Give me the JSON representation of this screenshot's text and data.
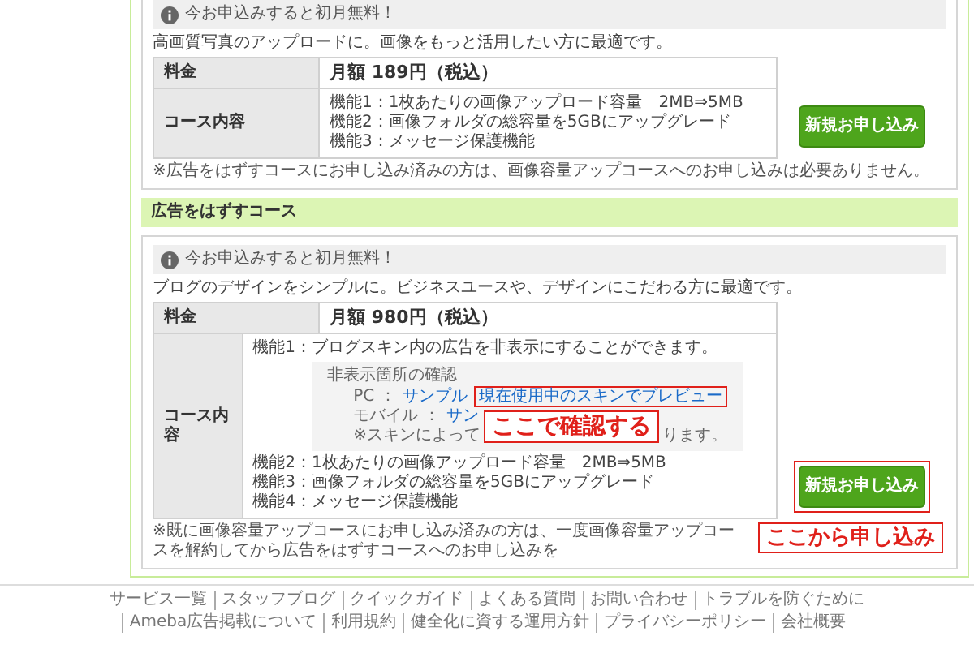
{
  "courses": [
    {
      "notice": "今お申込みすると初月無料！",
      "description": "高画質写真のアップロードに。画像をもっと活用したい方に最適です。",
      "price_label": "料金",
      "price": "月額 189円（税込）",
      "content_label": "コース内容",
      "features": [
        {
          "kind": "line",
          "text": "機能1：1枚あたりの画像アップロード容量　2MB⇒5MB"
        },
        {
          "kind": "line",
          "text": "機能2：画像フォルダの総容量を5GBにアップグレード"
        },
        {
          "kind": "line",
          "text": "機能3：メッセージ保護機能"
        }
      ],
      "button": {
        "label": "新規お申し込み",
        "highlighted": false
      },
      "footnote": "※広告をはずすコースにお申し込み済みの方は、画像容量アップコースへのお申し込みは必要ありません。"
    },
    {
      "heading": "広告をはずすコース",
      "notice": "今お申込みすると初月無料！",
      "description": "ブログのデザインをシンプルに。ビジネスユースや、デザインにこだわる方に最適です。",
      "price_label": "料金",
      "price": "月額 980円（税込）",
      "content_label": "コース内容",
      "features": [
        {
          "kind": "line",
          "text": "機能1：ブログスキン内の広告を非表示にすることができます。"
        },
        {
          "kind": "preview",
          "title": "非表示箇所の確認",
          "pc_label": "PC ：",
          "pc_sample": "サンプル",
          "pc_preview": "現在使用中のスキンでプレビュー",
          "mobile_label": "モバイル ：",
          "mobile_sample": "サン",
          "note_start": "※スキンによって",
          "note_end": "ります。",
          "callout": "ここで確認する"
        },
        {
          "kind": "line",
          "text": "機能2：1枚あたりの画像アップロード容量　2MB⇒5MB"
        },
        {
          "kind": "line",
          "text": "機能3：画像フォルダの総容量を5GBにアップグレード"
        },
        {
          "kind": "line",
          "text": "機能4：メッセージ保護機能"
        }
      ],
      "button": {
        "label": "新規お申し込み",
        "highlighted": true,
        "callout": "ここから申し込み"
      },
      "footnote": "※既に画像容量アップコースにお申し込み済みの方は、一度画像容量アップコースを解約してから広告をはずすコースへのお申し込みを"
    }
  ],
  "footer": {
    "links": [
      "サービス一覧",
      "スタッフブログ",
      "クイックガイド",
      "よくある質問",
      "お問い合わせ",
      "トラブルを防ぐために",
      "Ameba広告掲載について",
      "利用規約",
      "健全化に資する運用方針",
      "プライバシーポリシー",
      "会社概要"
    ]
  }
}
